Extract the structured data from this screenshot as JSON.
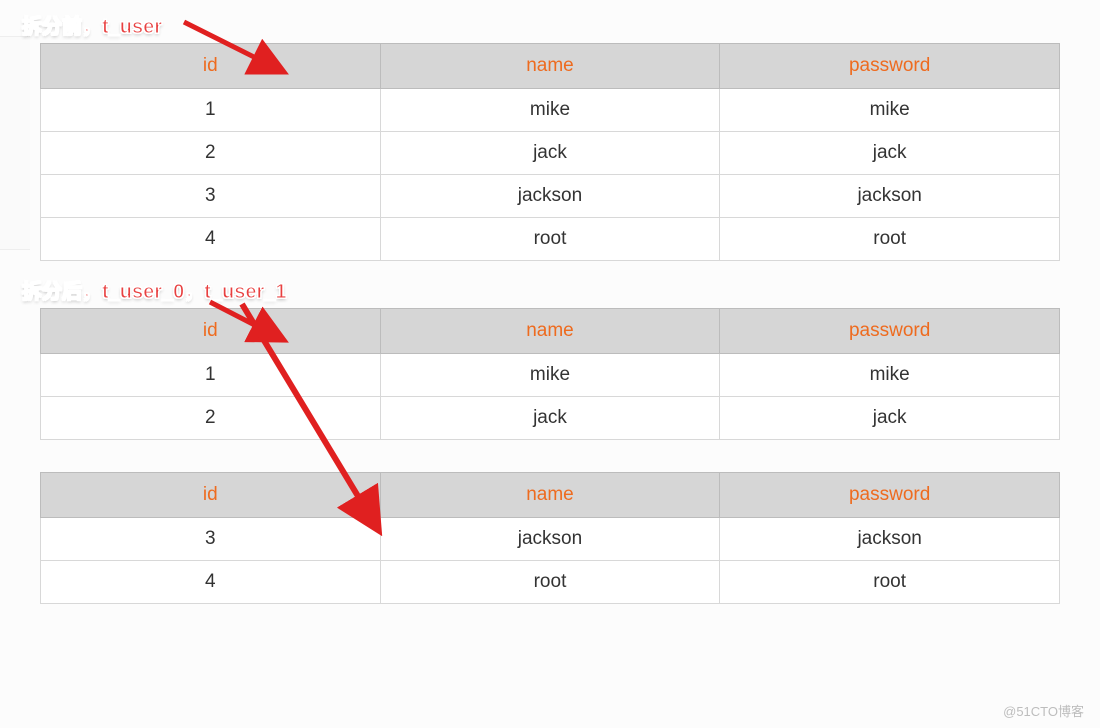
{
  "labels": {
    "before": "拆分前，t_user",
    "after": "拆分后，t_user_0，t_user_1"
  },
  "headers": {
    "id": "id",
    "name": "name",
    "password": "password"
  },
  "tables": {
    "before": [
      {
        "id": "1",
        "name": "mike",
        "password": "mike"
      },
      {
        "id": "2",
        "name": "jack",
        "password": "jack"
      },
      {
        "id": "3",
        "name": "jackson",
        "password": "jackson"
      },
      {
        "id": "4",
        "name": "root",
        "password": "root"
      }
    ],
    "after0": [
      {
        "id": "1",
        "name": "mike",
        "password": "mike"
      },
      {
        "id": "2",
        "name": "jack",
        "password": "jack"
      }
    ],
    "after1": [
      {
        "id": "3",
        "name": "jackson",
        "password": "jackson"
      },
      {
        "id": "4",
        "name": "root",
        "password": "root"
      }
    ]
  },
  "credit": "@51CTO博客"
}
